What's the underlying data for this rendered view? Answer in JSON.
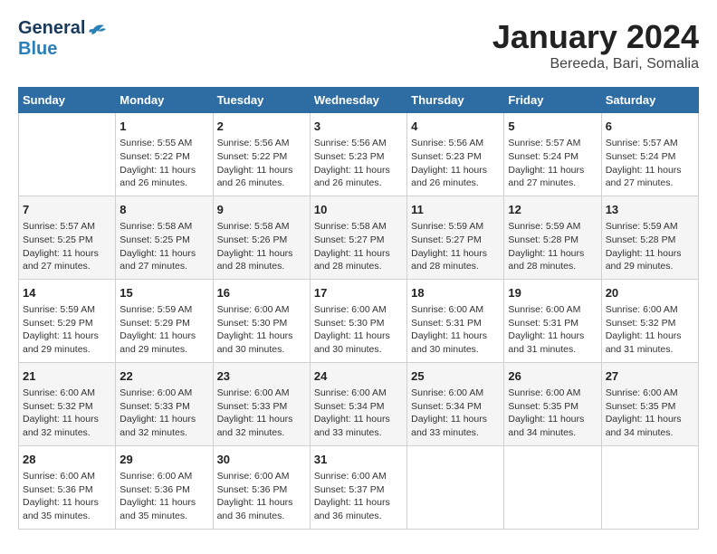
{
  "header": {
    "logo_general": "General",
    "logo_blue": "Blue",
    "main_title": "January 2024",
    "subtitle": "Bereeda, Bari, Somalia"
  },
  "weekdays": [
    "Sunday",
    "Monday",
    "Tuesday",
    "Wednesday",
    "Thursday",
    "Friday",
    "Saturday"
  ],
  "weeks": [
    [
      {
        "day": "",
        "info": ""
      },
      {
        "day": "1",
        "info": "Sunrise: 5:55 AM\nSunset: 5:22 PM\nDaylight: 11 hours\nand 26 minutes."
      },
      {
        "day": "2",
        "info": "Sunrise: 5:56 AM\nSunset: 5:22 PM\nDaylight: 11 hours\nand 26 minutes."
      },
      {
        "day": "3",
        "info": "Sunrise: 5:56 AM\nSunset: 5:23 PM\nDaylight: 11 hours\nand 26 minutes."
      },
      {
        "day": "4",
        "info": "Sunrise: 5:56 AM\nSunset: 5:23 PM\nDaylight: 11 hours\nand 26 minutes."
      },
      {
        "day": "5",
        "info": "Sunrise: 5:57 AM\nSunset: 5:24 PM\nDaylight: 11 hours\nand 27 minutes."
      },
      {
        "day": "6",
        "info": "Sunrise: 5:57 AM\nSunset: 5:24 PM\nDaylight: 11 hours\nand 27 minutes."
      }
    ],
    [
      {
        "day": "7",
        "info": "Sunrise: 5:57 AM\nSunset: 5:25 PM\nDaylight: 11 hours\nand 27 minutes."
      },
      {
        "day": "8",
        "info": "Sunrise: 5:58 AM\nSunset: 5:25 PM\nDaylight: 11 hours\nand 27 minutes."
      },
      {
        "day": "9",
        "info": "Sunrise: 5:58 AM\nSunset: 5:26 PM\nDaylight: 11 hours\nand 28 minutes."
      },
      {
        "day": "10",
        "info": "Sunrise: 5:58 AM\nSunset: 5:27 PM\nDaylight: 11 hours\nand 28 minutes."
      },
      {
        "day": "11",
        "info": "Sunrise: 5:59 AM\nSunset: 5:27 PM\nDaylight: 11 hours\nand 28 minutes."
      },
      {
        "day": "12",
        "info": "Sunrise: 5:59 AM\nSunset: 5:28 PM\nDaylight: 11 hours\nand 28 minutes."
      },
      {
        "day": "13",
        "info": "Sunrise: 5:59 AM\nSunset: 5:28 PM\nDaylight: 11 hours\nand 29 minutes."
      }
    ],
    [
      {
        "day": "14",
        "info": "Sunrise: 5:59 AM\nSunset: 5:29 PM\nDaylight: 11 hours\nand 29 minutes."
      },
      {
        "day": "15",
        "info": "Sunrise: 5:59 AM\nSunset: 5:29 PM\nDaylight: 11 hours\nand 29 minutes."
      },
      {
        "day": "16",
        "info": "Sunrise: 6:00 AM\nSunset: 5:30 PM\nDaylight: 11 hours\nand 30 minutes."
      },
      {
        "day": "17",
        "info": "Sunrise: 6:00 AM\nSunset: 5:30 PM\nDaylight: 11 hours\nand 30 minutes."
      },
      {
        "day": "18",
        "info": "Sunrise: 6:00 AM\nSunset: 5:31 PM\nDaylight: 11 hours\nand 30 minutes."
      },
      {
        "day": "19",
        "info": "Sunrise: 6:00 AM\nSunset: 5:31 PM\nDaylight: 11 hours\nand 31 minutes."
      },
      {
        "day": "20",
        "info": "Sunrise: 6:00 AM\nSunset: 5:32 PM\nDaylight: 11 hours\nand 31 minutes."
      }
    ],
    [
      {
        "day": "21",
        "info": "Sunrise: 6:00 AM\nSunset: 5:32 PM\nDaylight: 11 hours\nand 32 minutes."
      },
      {
        "day": "22",
        "info": "Sunrise: 6:00 AM\nSunset: 5:33 PM\nDaylight: 11 hours\nand 32 minutes."
      },
      {
        "day": "23",
        "info": "Sunrise: 6:00 AM\nSunset: 5:33 PM\nDaylight: 11 hours\nand 32 minutes."
      },
      {
        "day": "24",
        "info": "Sunrise: 6:00 AM\nSunset: 5:34 PM\nDaylight: 11 hours\nand 33 minutes."
      },
      {
        "day": "25",
        "info": "Sunrise: 6:00 AM\nSunset: 5:34 PM\nDaylight: 11 hours\nand 33 minutes."
      },
      {
        "day": "26",
        "info": "Sunrise: 6:00 AM\nSunset: 5:35 PM\nDaylight: 11 hours\nand 34 minutes."
      },
      {
        "day": "27",
        "info": "Sunrise: 6:00 AM\nSunset: 5:35 PM\nDaylight: 11 hours\nand 34 minutes."
      }
    ],
    [
      {
        "day": "28",
        "info": "Sunrise: 6:00 AM\nSunset: 5:36 PM\nDaylight: 11 hours\nand 35 minutes."
      },
      {
        "day": "29",
        "info": "Sunrise: 6:00 AM\nSunset: 5:36 PM\nDaylight: 11 hours\nand 35 minutes."
      },
      {
        "day": "30",
        "info": "Sunrise: 6:00 AM\nSunset: 5:36 PM\nDaylight: 11 hours\nand 36 minutes."
      },
      {
        "day": "31",
        "info": "Sunrise: 6:00 AM\nSunset: 5:37 PM\nDaylight: 11 hours\nand 36 minutes."
      },
      {
        "day": "",
        "info": ""
      },
      {
        "day": "",
        "info": ""
      },
      {
        "day": "",
        "info": ""
      }
    ]
  ]
}
